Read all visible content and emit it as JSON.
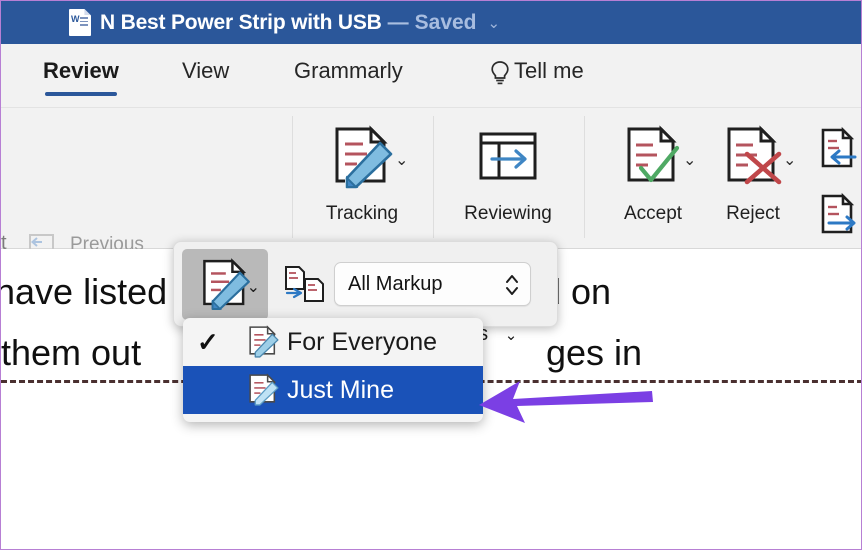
{
  "titlebar": {
    "app_icon": "word-document-icon",
    "document_title": "N Best Power Strip with USB",
    "dash": "—",
    "save_status": "Saved",
    "chevron": "⌄",
    "bg_color": "#2b579a"
  },
  "tabs": [
    {
      "label": "Review",
      "active": true
    },
    {
      "label": "View",
      "active": false
    },
    {
      "label": "Grammarly",
      "active": false
    },
    {
      "label": "Tell me",
      "active": false,
      "icon": "lightbulb-icon"
    }
  ],
  "ribbon": {
    "clipped_left_text": "t",
    "comments_group": {
      "previous_label": "Previous",
      "next_label": "Next",
      "show_comments_label": "Show Comments",
      "show_comments_chevron": "⌄"
    },
    "tracking_group": {
      "tracking_label": "Tracking",
      "tracking_chevron": "⌄",
      "reviewing_label": "Reviewing"
    },
    "changes_group": {
      "accept_label": "Accept",
      "accept_chevron": "⌄",
      "reject_label": "Reject",
      "reject_chevron": "⌄",
      "previous_change_icon": "previous-change-icon",
      "next_change_icon": "next-change-icon"
    }
  },
  "popup": {
    "track_changes_icon": "track-changes-icon",
    "track_changes_chevron": "⌄",
    "compare_icon": "compare-documents-icon",
    "markup_select_value": "All Markup",
    "stepper_up": "⌃",
    "stepper_down": "⌄",
    "hidden_options_label": "ns",
    "hidden_options_chevron": "⌄"
  },
  "dropdown": {
    "items": [
      {
        "label": "For Everyone",
        "checked": true,
        "selected": false,
        "check_glyph": "✓"
      },
      {
        "label": "Just Mine",
        "checked": false,
        "selected": true,
        "check_glyph": ""
      }
    ],
    "highlight_color": "#1a52b8"
  },
  "document": {
    "lines": [
      "have listed",
      "them out",
      "d on",
      "ges in"
    ],
    "section_break": "dashed-section-break"
  },
  "annotation": {
    "arrow_icon": "purple-left-arrow-annotation",
    "arrow_color": "#7b3fe4"
  }
}
